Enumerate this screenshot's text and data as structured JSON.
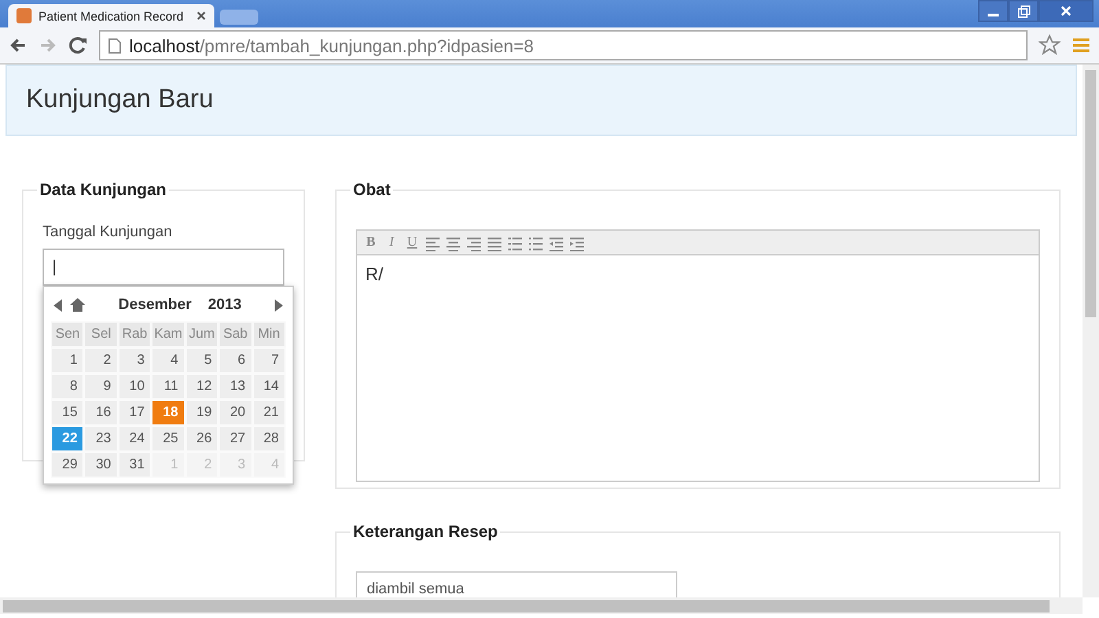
{
  "browser": {
    "tab_title": "Patient Medication Record",
    "url_host": "localhost",
    "url_path": "/pmre/tambah_kunjungan.php?idpasien=8"
  },
  "page": {
    "title": "Kunjungan Baru"
  },
  "data_kunjungan": {
    "legend": "Data Kunjungan",
    "date_label": "Tanggal Kunjungan",
    "date_value": "|"
  },
  "calendar": {
    "month": "Desember",
    "year": "2013",
    "weekdays": [
      "Sen",
      "Sel",
      "Rab",
      "Kam",
      "Jum",
      "Sab",
      "Min"
    ],
    "days": [
      {
        "label": "1",
        "muted": false,
        "selected": false,
        "today": false
      },
      {
        "label": "2",
        "muted": false,
        "selected": false,
        "today": false
      },
      {
        "label": "3",
        "muted": false,
        "selected": false,
        "today": false
      },
      {
        "label": "4",
        "muted": false,
        "selected": false,
        "today": false
      },
      {
        "label": "5",
        "muted": false,
        "selected": false,
        "today": false
      },
      {
        "label": "6",
        "muted": false,
        "selected": false,
        "today": false
      },
      {
        "label": "7",
        "muted": false,
        "selected": false,
        "today": false
      },
      {
        "label": "8",
        "muted": false,
        "selected": false,
        "today": false
      },
      {
        "label": "9",
        "muted": false,
        "selected": false,
        "today": false
      },
      {
        "label": "10",
        "muted": false,
        "selected": false,
        "today": false
      },
      {
        "label": "11",
        "muted": false,
        "selected": false,
        "today": false
      },
      {
        "label": "12",
        "muted": false,
        "selected": false,
        "today": false
      },
      {
        "label": "13",
        "muted": false,
        "selected": false,
        "today": false
      },
      {
        "label": "14",
        "muted": false,
        "selected": false,
        "today": false
      },
      {
        "label": "15",
        "muted": false,
        "selected": false,
        "today": false
      },
      {
        "label": "16",
        "muted": false,
        "selected": false,
        "today": false
      },
      {
        "label": "17",
        "muted": false,
        "selected": false,
        "today": false
      },
      {
        "label": "18",
        "muted": false,
        "selected": false,
        "today": true
      },
      {
        "label": "19",
        "muted": false,
        "selected": false,
        "today": false
      },
      {
        "label": "20",
        "muted": false,
        "selected": false,
        "today": false
      },
      {
        "label": "21",
        "muted": false,
        "selected": false,
        "today": false
      },
      {
        "label": "22",
        "muted": false,
        "selected": true,
        "today": false
      },
      {
        "label": "23",
        "muted": false,
        "selected": false,
        "today": false
      },
      {
        "label": "24",
        "muted": false,
        "selected": false,
        "today": false
      },
      {
        "label": "25",
        "muted": false,
        "selected": false,
        "today": false
      },
      {
        "label": "26",
        "muted": false,
        "selected": false,
        "today": false
      },
      {
        "label": "27",
        "muted": false,
        "selected": false,
        "today": false
      },
      {
        "label": "28",
        "muted": false,
        "selected": false,
        "today": false
      },
      {
        "label": "29",
        "muted": false,
        "selected": false,
        "today": false
      },
      {
        "label": "30",
        "muted": false,
        "selected": false,
        "today": false
      },
      {
        "label": "31",
        "muted": false,
        "selected": false,
        "today": false
      },
      {
        "label": "1",
        "muted": true,
        "selected": false,
        "today": false
      },
      {
        "label": "2",
        "muted": true,
        "selected": false,
        "today": false
      },
      {
        "label": "3",
        "muted": true,
        "selected": false,
        "today": false
      },
      {
        "label": "4",
        "muted": true,
        "selected": false,
        "today": false
      }
    ]
  },
  "obat": {
    "legend": "Obat",
    "toolbar": [
      {
        "kind": "bold",
        "label": "B"
      },
      {
        "kind": "italic",
        "label": "I"
      },
      {
        "kind": "underline",
        "label": "U"
      },
      {
        "kind": "align-left"
      },
      {
        "kind": "align-center"
      },
      {
        "kind": "align-right"
      },
      {
        "kind": "justify"
      },
      {
        "kind": "numbered-list"
      },
      {
        "kind": "bullet-list"
      },
      {
        "kind": "outdent"
      },
      {
        "kind": "indent"
      }
    ],
    "content": "R/"
  },
  "keterangan": {
    "legend": "Keterangan Resep",
    "value": "diambil semua"
  }
}
